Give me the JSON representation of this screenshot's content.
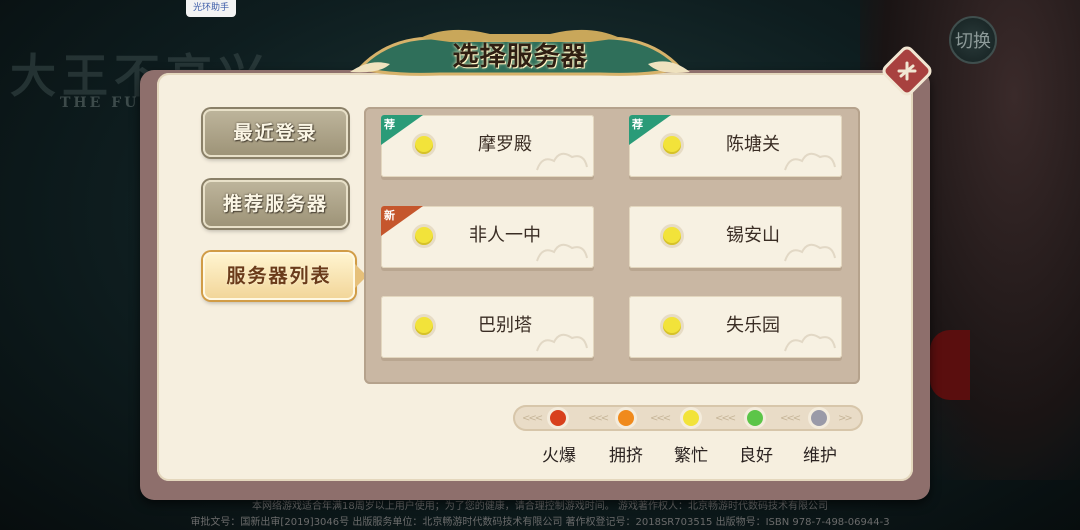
{
  "background": {
    "logo_text": "大王不高兴",
    "logo_subtitle": "THE FU",
    "assistant_badge": "光环助手",
    "switch_button": "切换",
    "footer_line1": "本网络游戏适合年满18周岁以上用户使用；为了您的健康，请合理控制游戏时间。 游戏著作权人：北京畅游时代数码技术有限公司",
    "footer_line2": "审批文号：国新出审[2019]3046号   出版服务单位：北京畅游时代数码技术有限公司   著作权登记号：2018SR703515   出版物号：ISBN 978-7-498-06944-3"
  },
  "dialog": {
    "title": "选择服务器",
    "close_icon": "close-seal-icon"
  },
  "tabs": [
    {
      "label": "最近登录",
      "selected": false
    },
    {
      "label": "推荐服务器",
      "selected": false
    },
    {
      "label": "服务器列表",
      "selected": true
    }
  ],
  "servers": [
    {
      "name": "摩罗殿",
      "tag": "荐",
      "status": "繁忙"
    },
    {
      "name": "陈塘关",
      "tag": "荐",
      "status": "繁忙"
    },
    {
      "name": "非人一中",
      "tag": "新",
      "status": "繁忙"
    },
    {
      "name": "锡安山",
      "tag": "",
      "status": "繁忙"
    },
    {
      "name": "巴别塔",
      "tag": "",
      "status": "繁忙"
    },
    {
      "name": "失乐园",
      "tag": "",
      "status": "繁忙"
    }
  ],
  "legend": [
    {
      "label": "火爆",
      "color": "#d8401c"
    },
    {
      "label": "拥挤",
      "color": "#f08a1c"
    },
    {
      "label": "繁忙",
      "color": "#f2e33a"
    },
    {
      "label": "良好",
      "color": "#5cc548"
    },
    {
      "label": "维护",
      "color": "#9a9aa8"
    }
  ],
  "colors": {
    "tag_recommend": "#2a9b78",
    "tag_new": "#c5562c"
  }
}
